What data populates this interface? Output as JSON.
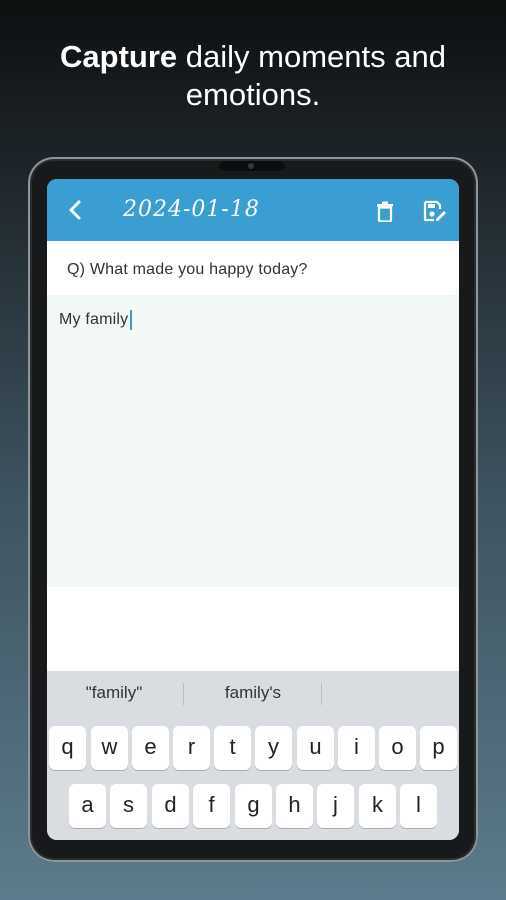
{
  "headline": {
    "bold": "Capture",
    "rest_line1": "daily moments and",
    "line2": "emotions."
  },
  "appbar": {
    "date": "2024-01-18",
    "back_icon": "chevron-left-icon",
    "delete_icon": "trash-icon",
    "save_icon": "save-edit-icon",
    "color": "#3a9ed3"
  },
  "question": {
    "text": "Q) What made you happy today?"
  },
  "answer": {
    "value": "My family"
  },
  "keyboard": {
    "suggestions": [
      "\"family\"",
      "family's"
    ],
    "row1": [
      "q",
      "w",
      "e",
      "r",
      "t",
      "y",
      "u",
      "i",
      "o",
      "p"
    ],
    "row2": [
      "a",
      "s",
      "d",
      "f",
      "g",
      "h",
      "j",
      "k",
      "l"
    ]
  }
}
